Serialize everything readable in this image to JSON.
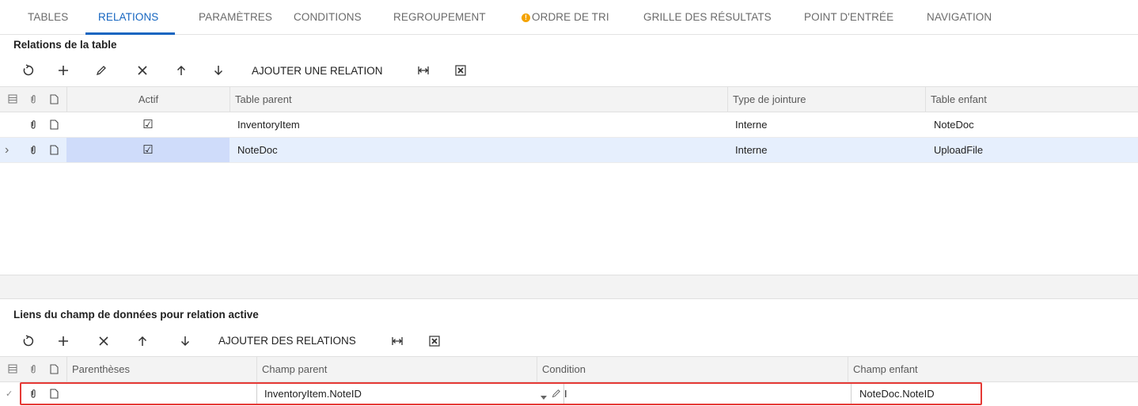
{
  "tabs": [
    {
      "label": "TABLES",
      "active": false
    },
    {
      "label": "RELATIONS",
      "active": true
    },
    {
      "label": "PARAMÈTRES",
      "active": false
    },
    {
      "label": "CONDITIONS",
      "active": false
    },
    {
      "label": "REGROUPEMENT",
      "active": false
    },
    {
      "label": "ORDRE DE TRI",
      "active": false,
      "warning": true
    },
    {
      "label": "GRILLE DES RÉSULTATS",
      "active": false
    },
    {
      "label": "POINT D'ENTRÉE",
      "active": false
    },
    {
      "label": "NAVIGATION",
      "active": false
    }
  ],
  "warning_glyph": "!",
  "relations": {
    "title": "Relations de la table",
    "toolbar": {
      "add_relation_label": "AJOUTER UNE RELATION"
    },
    "columns": {
      "actif": "Actif",
      "parent": "Table parent",
      "join": "Type de jointure",
      "child": "Table enfant"
    },
    "rows": [
      {
        "actif": "☑",
        "parent": "InventoryItem",
        "join": "Interne",
        "child": "NoteDoc",
        "selected": false
      },
      {
        "actif": "☑",
        "parent": "NoteDoc",
        "join": "Interne",
        "child": "UploadFile",
        "selected": true
      }
    ],
    "row_indicator": "›"
  },
  "links": {
    "title": "Liens du champ de données pour relation active",
    "toolbar": {
      "add_relations_label": "AJOUTER DES RELATIONS"
    },
    "columns": {
      "paren": "Parenthèses",
      "parent_field": "Champ parent",
      "condition": "Condition",
      "child_field": "Champ enfant"
    },
    "rows": [
      {
        "paren": "",
        "parent_field": "InventoryItem.NoteID",
        "condition": "I",
        "child_field": "NoteDoc.NoteID"
      }
    ],
    "row_indicator": "✓"
  },
  "colors": {
    "accent": "#1565c0",
    "warning": "#f4a300",
    "highlight_border": "#e53935",
    "selected_row": "#e6effd"
  },
  "icons": [
    "refresh-icon",
    "plus-icon",
    "pencil-icon",
    "close-icon",
    "arrow-up-icon",
    "arrow-down-icon",
    "fit-columns-icon",
    "excel-icon",
    "paperclip-icon",
    "file-icon",
    "settings-grid-icon",
    "checkbox-checked-icon",
    "dropdown-arrow-icon"
  ]
}
